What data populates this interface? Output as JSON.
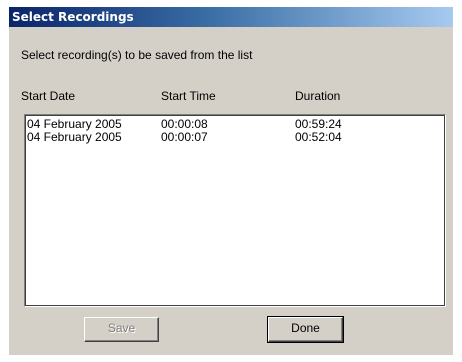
{
  "window": {
    "title": "Select Recordings"
  },
  "instruction": "Select recording(s) to be saved from the list",
  "columns": {
    "start_date": "Start Date",
    "start_time": "Start Time",
    "duration": "Duration"
  },
  "recordings": [
    {
      "start_date": "04 February 2005",
      "start_time": "00:00:08",
      "duration": "00:59:24"
    },
    {
      "start_date": "04 February 2005",
      "start_time": "00:00:07",
      "duration": "00:52:04"
    }
  ],
  "buttons": {
    "save_label": "Save",
    "save_enabled": false,
    "done_label": "Done"
  },
  "colors": {
    "titlebar_start": "#0a246a",
    "titlebar_end": "#a6caf0",
    "dialog_background": "#d4d0c8"
  }
}
